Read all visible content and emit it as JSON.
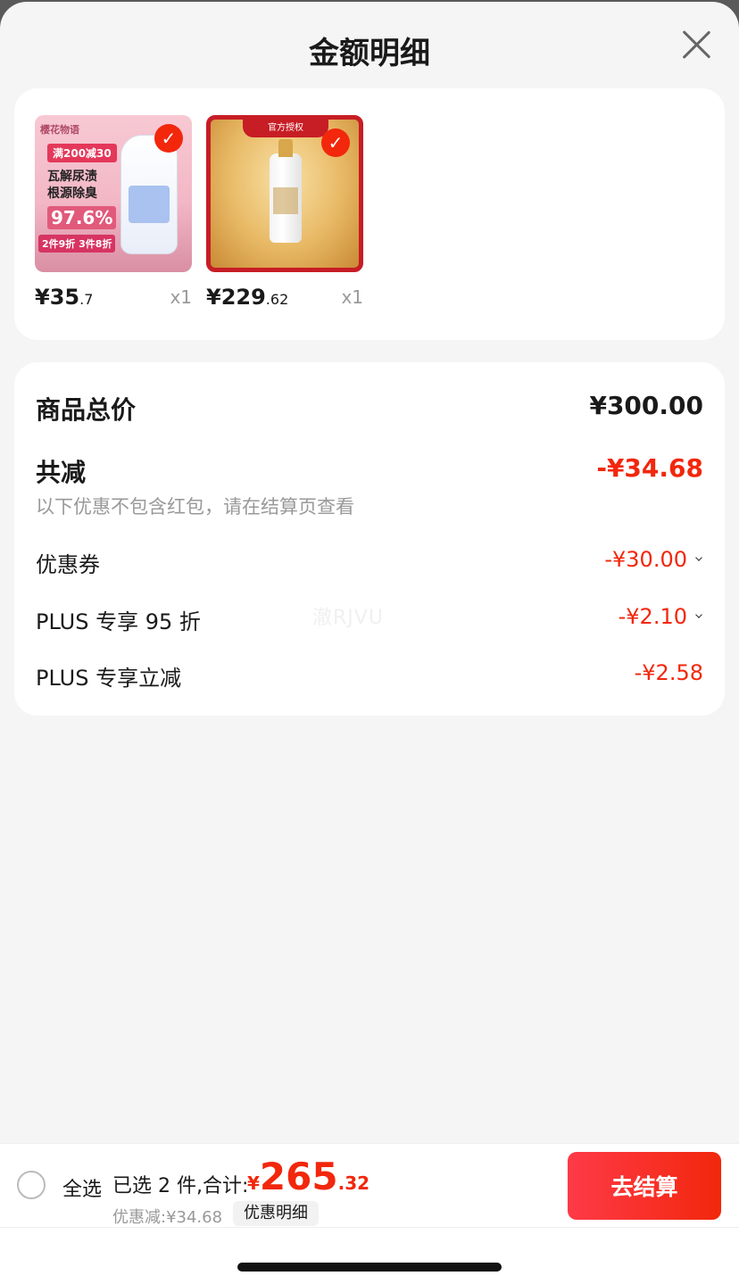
{
  "header": {
    "title": "金额明细"
  },
  "products": [
    {
      "price_int": "¥35",
      "price_dec": ".7",
      "qty": "x1",
      "image": {
        "brand": "樱花物语",
        "badge": "满200减30",
        "text": "瓦解尿渍 根源除臭",
        "percent": "97.6%",
        "deal": "2件9折 3件8折"
      }
    },
    {
      "price_int": "¥229",
      "price_dec": ".62",
      "qty": "x1",
      "image": {
        "ribbon": "官方授权"
      }
    }
  ],
  "summary": {
    "total_label": "商品总价",
    "total_value": "¥300.00",
    "reduce_label": "共减",
    "reduce_value": "-¥34.68",
    "note": "以下优惠不包含红包，请在结算页查看",
    "items": [
      {
        "label": "优惠券",
        "value": "-¥30.00",
        "expandable": true
      },
      {
        "label": "PLUS 专享 95 折",
        "value": "-¥2.10",
        "expandable": true
      },
      {
        "label": "PLUS 专享立减",
        "value": "-¥2.58",
        "expandable": false
      }
    ]
  },
  "watermark": "澈RJVU",
  "footer": {
    "select_all": "全选",
    "selected_text": "已选 2 件,合计:",
    "total_symbol": "¥",
    "total_int": "265",
    "total_dec": ".32",
    "discount_text": "优惠减:¥34.68",
    "detail_button": "优惠明细",
    "checkout_button": "去结算"
  },
  "colors": {
    "accent": "#f2270c",
    "muted": "#999999"
  }
}
